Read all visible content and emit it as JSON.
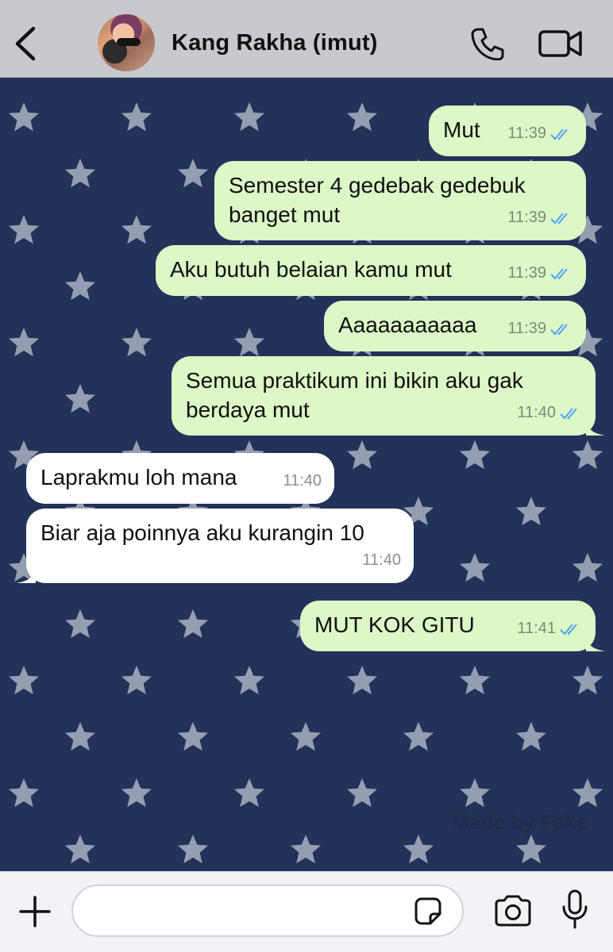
{
  "header": {
    "title": "Kang Rakha (imut)",
    "icons": [
      "back-icon",
      "avatar",
      "phone-icon",
      "video-icon"
    ]
  },
  "colors": {
    "header_bg": "#c8c9ce",
    "outgoing_bubble": "#dcf8c6",
    "incoming_bubble": "#ffffff",
    "chat_bg": "#213158",
    "read_ticks": "#4fa3f7"
  },
  "messages": [
    {
      "dir": "out",
      "text": "Mut",
      "time": "11:39",
      "read": true
    },
    {
      "dir": "out",
      "text": "Semester 4 gedebak gedebuk\nbanget mut",
      "time": "11:39",
      "read": true
    },
    {
      "dir": "out",
      "text": "Aku butuh belaian kamu mut",
      "time": "11:39",
      "read": true
    },
    {
      "dir": "out",
      "text": "Aaaaaaaaaaa",
      "time": "11:39",
      "read": true
    },
    {
      "dir": "out",
      "text": "Semua praktikum ini bikin aku gak\nberdaya mut",
      "time": "11:40",
      "read": true
    },
    {
      "dir": "in",
      "text": "Laprakmu loh mana",
      "time": "11:40"
    },
    {
      "dir": "in",
      "text": "Biar aja poinnya aku kurangin 10",
      "time": "11:40"
    },
    {
      "dir": "out",
      "text": "MUT KOK GITU",
      "time": "11:41",
      "read": true
    }
  ],
  "watermark": "Made by Fake",
  "footer": {
    "input_placeholder": "",
    "icons": [
      "plus-icon",
      "sticker-icon",
      "camera-icon",
      "mic-icon"
    ]
  }
}
